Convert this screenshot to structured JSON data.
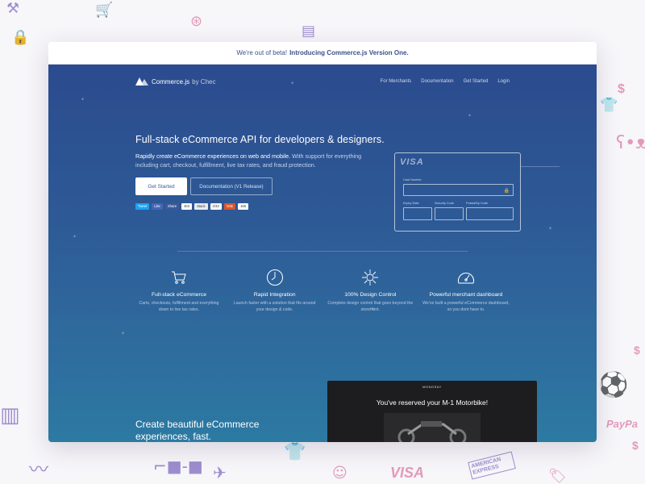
{
  "beta_bar": {
    "prefix": "We're out of beta!",
    "link": "Introducing Commerce.js Version One."
  },
  "nav": {
    "logo_text": "Commerce.js",
    "logo_by": "by Chec",
    "links": [
      "For Merchants",
      "Documentation",
      "Get Started",
      "Login"
    ]
  },
  "hero": {
    "headline": "Full-stack eCommerce API for developers & designers.",
    "sub_bold": "Rapidly create eCommerce experiences on web and mobile.",
    "sub_rest": "With support for everything including cart, checkout, fulfillment, live tax rates, and fraud protection.",
    "primary_button": "Get Started",
    "secondary_button": "Documentation (V1 Release)"
  },
  "social": {
    "tweet": "Tweet",
    "like": "Like",
    "share": "Share",
    "share_count": "304",
    "stack": "Stack",
    "stack_count": "2/33",
    "vote": "Vote",
    "vote_count": "165"
  },
  "card_mock": {
    "brand": "VISA",
    "card_number_label": "Card Number",
    "expiry_label": "Expiry Date",
    "security_label": "Security Code",
    "postal_label": "Postal/Zip Code"
  },
  "features": [
    {
      "icon": "cart-icon",
      "title": "Full-stack eCommerce",
      "desc": "Carts, checkouts, fulfillment and everything down to live tax rates."
    },
    {
      "icon": "timer-icon",
      "title": "Rapid Integration",
      "desc": "Launch faster with a solution that fits around your design & code."
    },
    {
      "icon": "design-icon",
      "title": "100% Design Control",
      "desc": "Complete design control that goes beyond the storefront."
    },
    {
      "icon": "gauge-icon",
      "title": "Powerful merchant dashboard",
      "desc": "We've built a powerful eCommerce dashboard, so you dont have to."
    }
  ],
  "lower": {
    "title": "Create beautiful eCommerce experiences, fast.",
    "video_brand": "MONOSAY",
    "video_title": "You've reserved your M-1 Motorbike!"
  },
  "doodles": {
    "dollar": "$",
    "paypal": "PayPa",
    "visa": "VISA",
    "amex": "AMERICAN EXPRESS"
  },
  "colors": {
    "hero_top": "#2b4b8e",
    "hero_bottom": "#2f6c9e",
    "accent_link": "#3c4f8a",
    "doodle_pink": "#e08ab0",
    "doodle_purple": "#8e7bc8"
  }
}
